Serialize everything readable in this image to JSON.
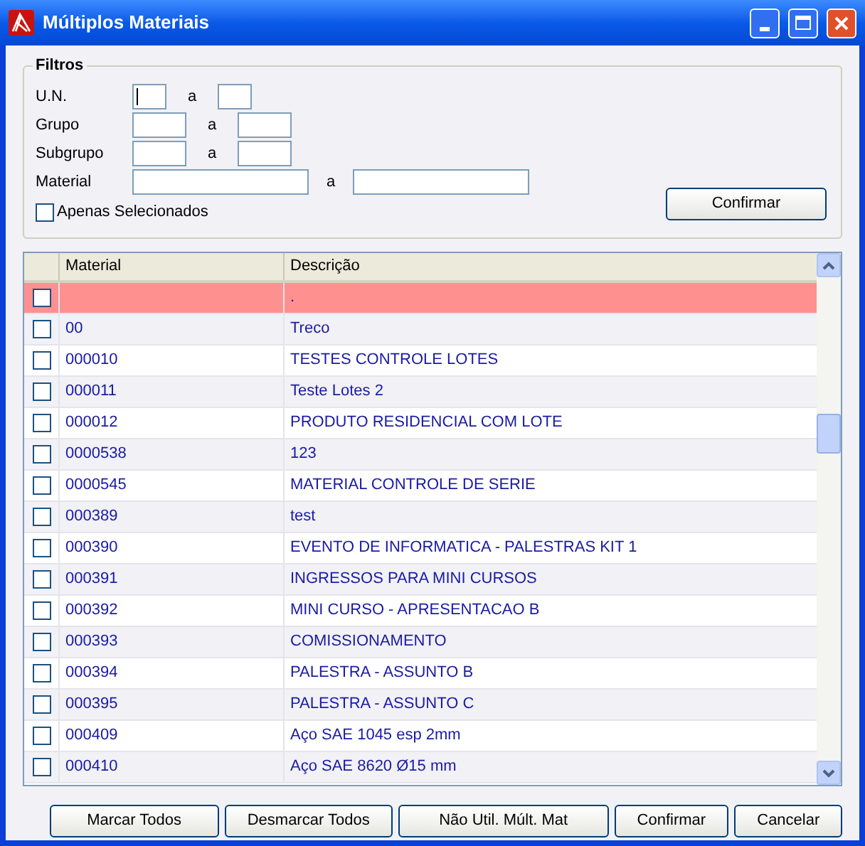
{
  "window": {
    "title": "Múltiplos Materiais"
  },
  "filters": {
    "title": "Filtros",
    "ranges": [
      {
        "kind": "short",
        "label": "U.N.",
        "separator": "a",
        "focused": true
      },
      {
        "kind": "medium",
        "label": "Grupo",
        "separator": "a",
        "focused": false
      },
      {
        "kind": "medium",
        "label": "Subgrupo",
        "separator": "a",
        "focused": false
      },
      {
        "kind": "long",
        "label": "Material",
        "separator": "a",
        "focused": false
      }
    ],
    "only_selected": {
      "label": "Apenas Selecionados",
      "checked": false
    },
    "confirm_button": "Confirmar"
  },
  "table": {
    "columns": [
      "Material",
      "Descrição"
    ],
    "rows": [
      {
        "material": "",
        "description": ".",
        "checked": false,
        "selected": true
      },
      {
        "material": "00",
        "description": "Treco",
        "checked": false,
        "selected": false
      },
      {
        "material": "000010",
        "description": "TESTES CONTROLE LOTES",
        "checked": false,
        "selected": false
      },
      {
        "material": "000011",
        "description": "Teste Lotes 2",
        "checked": false,
        "selected": false
      },
      {
        "material": "000012",
        "description": "PRODUTO RESIDENCIAL COM LOTE",
        "checked": false,
        "selected": false
      },
      {
        "material": "0000538",
        "description": "123",
        "checked": false,
        "selected": false
      },
      {
        "material": "0000545",
        "description": "MATERIAL CONTROLE DE SERIE",
        "checked": false,
        "selected": false
      },
      {
        "material": "000389",
        "description": "test",
        "checked": false,
        "selected": false
      },
      {
        "material": "000390",
        "description": "EVENTO DE INFORMATICA - PALESTRAS KIT 1",
        "checked": false,
        "selected": false
      },
      {
        "material": "000391",
        "description": "INGRESSOS PARA MINI CURSOS",
        "checked": false,
        "selected": false
      },
      {
        "material": "000392",
        "description": "MINI CURSO - APRESENTACAO B",
        "checked": false,
        "selected": false
      },
      {
        "material": "000393",
        "description": "COMISSIONAMENTO",
        "checked": false,
        "selected": false
      },
      {
        "material": "000394",
        "description": "PALESTRA - ASSUNTO B",
        "checked": false,
        "selected": false
      },
      {
        "material": "000395",
        "description": "PALESTRA - ASSUNTO C",
        "checked": false,
        "selected": false
      },
      {
        "material": "000409",
        "description": "Aço SAE 1045 esp 2mm",
        "checked": false,
        "selected": false
      },
      {
        "material": "000410",
        "description": "Aço SAE 8620 Ø15 mm",
        "checked": false,
        "selected": false
      }
    ]
  },
  "buttons": [
    "Marcar Todos",
    "Desmarcar Todos",
    "Não Util. Múlt. Mat",
    "Confirmar",
    "Cancelar"
  ]
}
